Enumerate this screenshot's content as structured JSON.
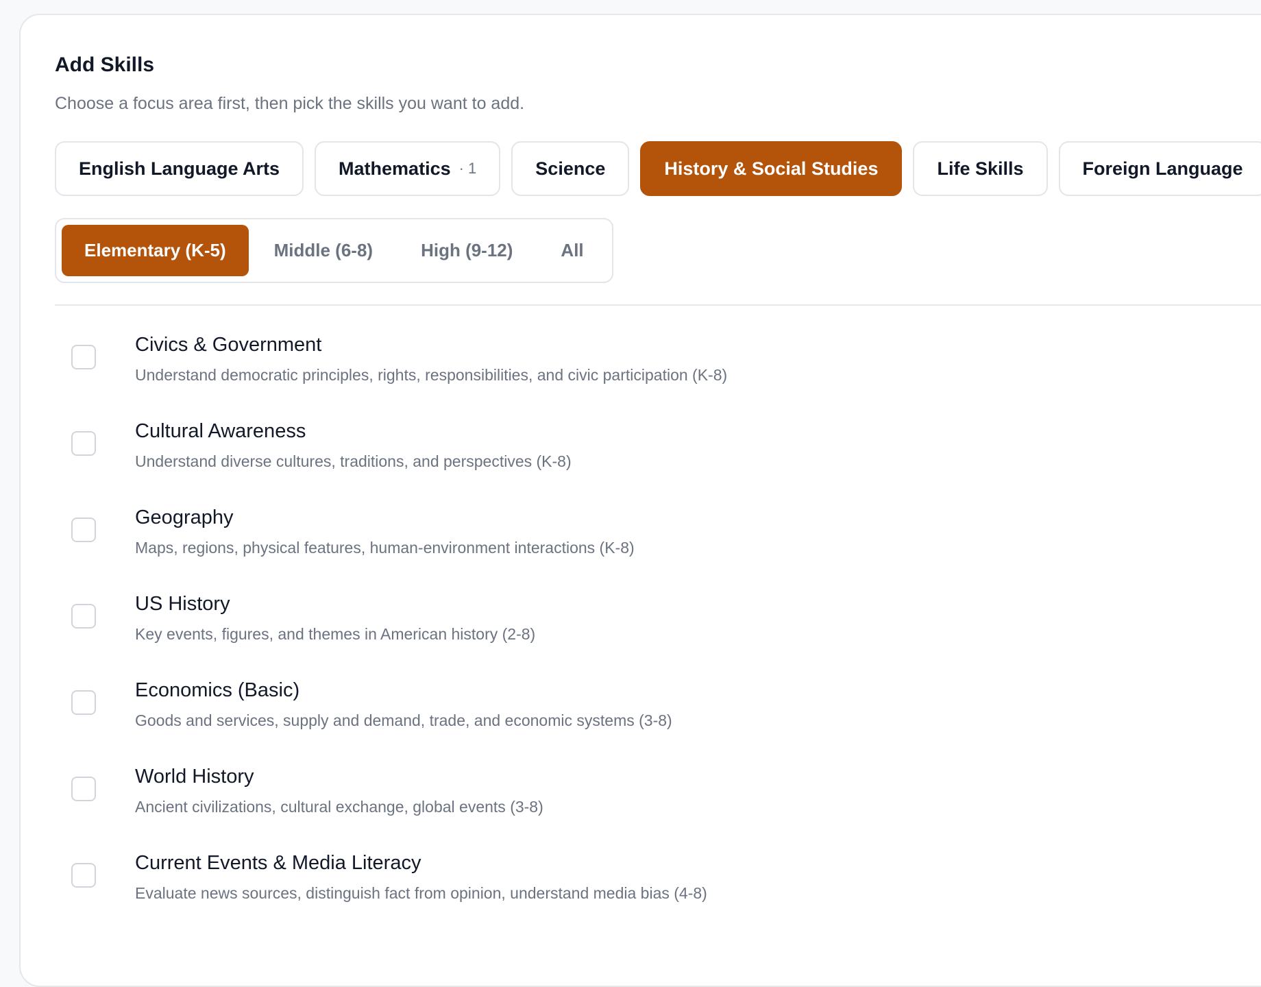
{
  "header": {
    "title": "Add Skills",
    "subtitle": "Choose a focus area first, then pick the skills you want to add."
  },
  "focus_areas": [
    {
      "label": "English Language Arts",
      "count": "",
      "active": false
    },
    {
      "label": "Mathematics",
      "count": "· 1",
      "active": false
    },
    {
      "label": "Science",
      "count": "",
      "active": false
    },
    {
      "label": "History & Social Studies",
      "count": "",
      "active": true
    },
    {
      "label": "Life Skills",
      "count": "",
      "active": false
    },
    {
      "label": "Foreign Language",
      "count": "",
      "active": false
    }
  ],
  "grade_levels": [
    {
      "label": "Elementary (K-5)",
      "active": true
    },
    {
      "label": "Middle (6-8)",
      "active": false
    },
    {
      "label": "High (9-12)",
      "active": false
    },
    {
      "label": "All",
      "active": false
    }
  ],
  "skills": [
    {
      "name": "Civics & Government",
      "description": "Understand democratic principles, rights, responsibilities, and civic participation (K-8)",
      "checked": false
    },
    {
      "name": "Cultural Awareness",
      "description": "Understand diverse cultures, traditions, and perspectives (K-8)",
      "checked": false
    },
    {
      "name": "Geography",
      "description": "Maps, regions, physical features, human-environment interactions (K-8)",
      "checked": false
    },
    {
      "name": "US History",
      "description": "Key events, figures, and themes in American history (2-8)",
      "checked": false
    },
    {
      "name": "Economics (Basic)",
      "description": "Goods and services, supply and demand, trade, and economic systems (3-8)",
      "checked": false
    },
    {
      "name": "World History",
      "description": "Ancient civilizations, cultural exchange, global events (3-8)",
      "checked": false
    },
    {
      "name": "Current Events & Media Literacy",
      "description": "Evaluate news sources, distinguish fact from opinion, understand media bias (4-8)",
      "checked": false
    }
  ],
  "colors": {
    "accent": "#b4530a",
    "text": "#111827",
    "muted": "#6b7280",
    "border": "#e2e5ea"
  }
}
